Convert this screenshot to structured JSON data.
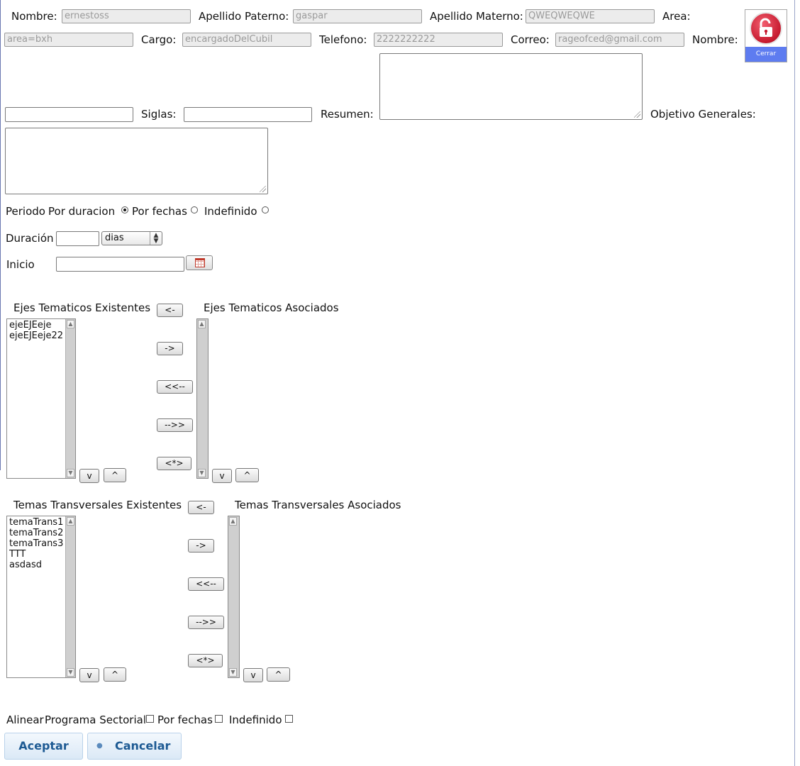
{
  "header": {
    "nombre_label": "Nombre:",
    "nombre_value": "ernestoss",
    "apellido_paterno_label": "Apellido Paterno:",
    "apellido_paterno_value": "gaspar",
    "apellido_materno_label": "Apellido Materno:",
    "apellido_materno_value": "QWEQWEQWE",
    "area_label": "Area:",
    "area_value": "area=bxh",
    "cargo_label": "Cargo:",
    "cargo_value": "encargadoDelCubil",
    "telefono_label": "Telefono:",
    "telefono_value": "2222222222",
    "correo_label": "Correo:",
    "correo_value": "rageofced@gmail.com",
    "logout_label": "Cerrar sesión."
  },
  "form": {
    "nombre_label": "Nombre:",
    "siglas_label": "Siglas:",
    "resumen_label": "Resumen:",
    "objetivo_label": "Objetivo Generales:",
    "periodo_label": "Periodo",
    "por_duracion_label": "Por duracion",
    "por_fechas_label": "Por fechas",
    "indefinido_label": "Indefinido",
    "periodo_selected": "Por duracion",
    "duracion_label": "Duración",
    "duracion_unit": "dias",
    "inicio_label": "Inicio"
  },
  "ejes": {
    "existentes_label": "Ejes Tematicos Existentes",
    "asociados_label": "Ejes Tematicos Asociados",
    "existentes": [
      "ejeEJEeje",
      "ejeEJEeje22"
    ],
    "asociados": []
  },
  "temas": {
    "existentes_label": "Temas Transversales Existentes",
    "asociados_label": "Temas Transversales Asociados",
    "existentes": [
      "temaTrans1",
      "temaTrans2",
      "temaTrans3",
      "TTT",
      "asdasd"
    ],
    "asociados": []
  },
  "transfer_buttons": {
    "left": "<-",
    "right": "->",
    "all_left": "<<--",
    "all_right": "-->>",
    "star": "<*>",
    "down": "v",
    "up": "^"
  },
  "alinear": {
    "label": "Alinear",
    "programa_label": "Programa Sectorial",
    "por_fechas_label": "Por fechas",
    "indefinido_label": "Indefinido"
  },
  "actions": {
    "aceptar": "Aceptar",
    "cancelar": "Cancelar"
  }
}
